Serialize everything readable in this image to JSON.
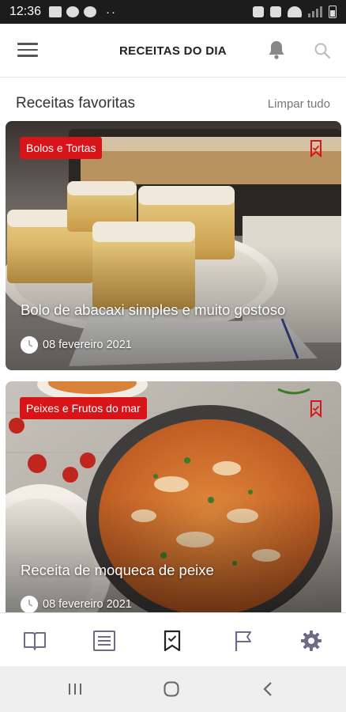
{
  "status_bar": {
    "time": "12:36",
    "dots": "··"
  },
  "header": {
    "title": "RECEITAS DO DIA"
  },
  "section": {
    "title": "Receitas favoritas",
    "clear_label": "Limpar tudo"
  },
  "cards": [
    {
      "category": "Bolos e Tortas",
      "title": "Bolo de abacaxi simples e muito gostoso",
      "date": "08 fevereiro 2021"
    },
    {
      "category": "Peixes e Frutos do mar",
      "title": "Receita de moqueca de peixe",
      "date": "08 fevereiro 2021"
    }
  ],
  "bottom_nav": [
    {
      "icon": "book-icon"
    },
    {
      "icon": "newspaper-icon"
    },
    {
      "icon": "bookmark-icon",
      "active": true
    },
    {
      "icon": "flag-icon"
    },
    {
      "icon": "gear-icon"
    }
  ],
  "colors": {
    "accent": "#d81418",
    "nav_icon": "#6e6a8a",
    "nav_active": "#222222"
  }
}
